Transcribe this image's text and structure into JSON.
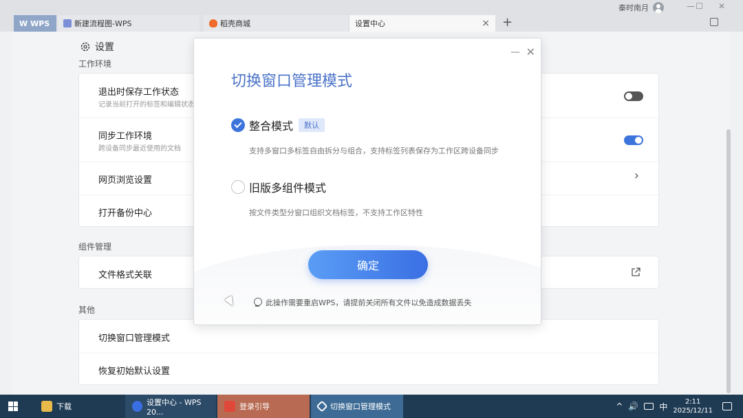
{
  "titlebar": {
    "user_name": "秦时南月",
    "min": "—",
    "max": "☐",
    "close": "✕",
    "tabs": [
      {
        "label": "WPS"
      },
      {
        "label": "新建流程图-WPS"
      },
      {
        "label": "稻壳商城"
      },
      {
        "label": "设置中心",
        "close": "×"
      }
    ],
    "new_tab": "+"
  },
  "settings": {
    "title": "设置",
    "sections": {
      "work_env": "工作环境",
      "components": "组件管理",
      "other": "其他"
    },
    "items": {
      "save_state": {
        "title": "退出时保存工作状态",
        "sub": "记录当前打开的标签和编辑状态",
        "on": false
      },
      "sync_env": {
        "title": "同步工作环境",
        "sub": "跨设备同步最近使用的文档",
        "on": true
      },
      "browse": {
        "title": "网页浏览设置"
      },
      "backup": {
        "title": "打开备份中心"
      },
      "file_assoc": {
        "title": "文件格式关联"
      },
      "switch_mode": {
        "title": "切换窗口管理模式"
      },
      "reset": {
        "title": "恢复初始默认设置"
      }
    }
  },
  "dialog": {
    "title": "切换窗口管理模式",
    "min": "—",
    "close": "✕",
    "option1": {
      "label": "整合模式",
      "badge": "默认",
      "desc": "支持多窗口多标签自由拆分与组合，支持标签列表保存为工作区跨设备同步",
      "selected": true
    },
    "option2": {
      "label": "旧版多组件模式",
      "desc": "按文件类型分窗口组织文档标签，不支持工作区特性",
      "selected": false
    },
    "confirm": "确定",
    "note": "此操作需要重启WPS，请提前关闭所有文件以免造成数据丢失"
  },
  "taskbar": {
    "tasks": [
      {
        "label": "下载"
      },
      {
        "label": "设置中心 - WPS 20..."
      },
      {
        "label": "登录引导"
      },
      {
        "label": "切换窗口管理模式"
      }
    ],
    "tray": {
      "up": "^",
      "volume": "🔊",
      "ime": "中"
    },
    "time": "2:11",
    "date": "2025/12/11"
  },
  "colors": {
    "accent": "#3c74dc",
    "toggle_on": "#3c74dc",
    "toggle_off": "#555555"
  }
}
